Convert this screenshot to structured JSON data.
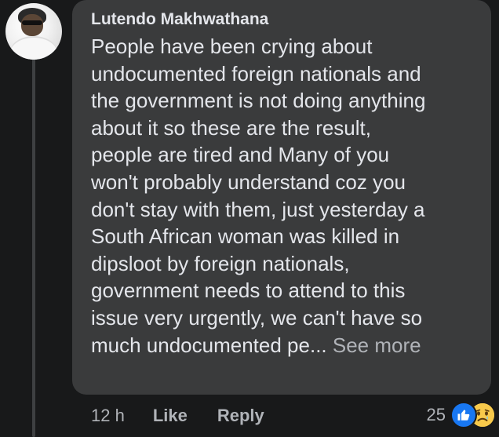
{
  "comment": {
    "author": "Lutendo Makhwathana",
    "text_lines": [
      "People have been crying about",
      "undocumented foreign nationals and",
      "the government is not doing anything",
      "about it so these are the result,",
      "people are tired and Many of you",
      "won't probably understand coz you",
      "don't stay with them, just yesterday a",
      "South African woman was killed in",
      "dipsloot by foreign nationals,",
      "government needs to attend to this",
      "issue very urgently, we can't have so",
      "much undocumented pe..."
    ],
    "see_more_label": "See more"
  },
  "actions": {
    "time": "12 h",
    "like_label": "Like",
    "reply_label": "Reply"
  },
  "reactions": {
    "count": "25",
    "icons": [
      "like-icon",
      "sad-icon"
    ]
  },
  "colors": {
    "background": "#18191a",
    "bubble": "#3a3b3c",
    "text": "#e4e6eb",
    "secondary_text": "#b0b3b8",
    "like_blue": "#1877f2",
    "sad_yellow": "#f7c94b"
  }
}
